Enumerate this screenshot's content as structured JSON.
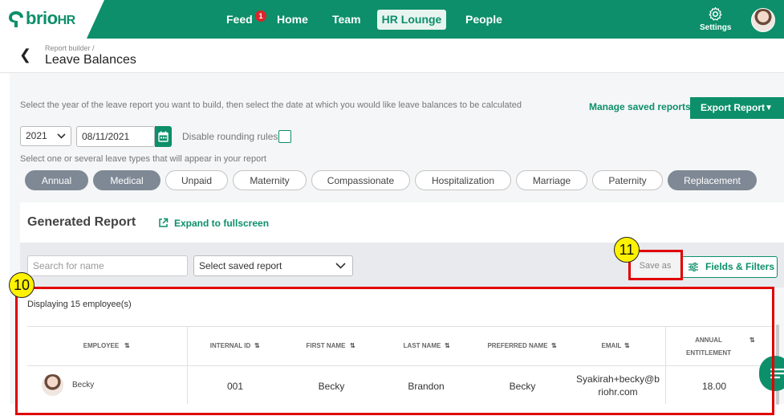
{
  "brand": {
    "name": "brio",
    "suffix": "HR"
  },
  "nav": {
    "feed": "Feed",
    "feed_badge": "1",
    "home": "Home",
    "team": "Team",
    "hr_lounge": "HR Lounge",
    "people": "People",
    "settings": "Settings"
  },
  "header": {
    "breadcrumb": "Report builder /",
    "title": "Leave Balances"
  },
  "form": {
    "info": "Select the year of the leave report you want to build, then select the date at which you would like leave balances to be calculated",
    "manage_saved": "Manage saved reports",
    "export": "Export Report",
    "year": "2021",
    "date": "08/11/2021",
    "disable_rounding": "Disable rounding rules",
    "leave_types_hint": "Select one or several leave types that will appear in your report",
    "leave_types": [
      {
        "label": "Annual",
        "selected": true
      },
      {
        "label": "Medical",
        "selected": true
      },
      {
        "label": "Unpaid",
        "selected": false
      },
      {
        "label": "Maternity",
        "selected": false
      },
      {
        "label": "Compassionate",
        "selected": false
      },
      {
        "label": "Hospitalization",
        "selected": false
      },
      {
        "label": "Marriage",
        "selected": false
      },
      {
        "label": "Paternity",
        "selected": false
      },
      {
        "label": "Replacement",
        "selected": true
      }
    ]
  },
  "report": {
    "title": "Generated Report",
    "expand": "Expand to fullscreen",
    "search_placeholder": "Search for name",
    "saved_select": "Select saved report",
    "save_as": "Save as",
    "fields_filters": "Fields & Filters",
    "displaying": "Displaying 15 employee(s)",
    "columns": [
      "EMPLOYEE",
      "INTERNAL ID",
      "FIRST NAME",
      "LAST NAME",
      "PREFERRED NAME",
      "EMAIL",
      "ANNUAL",
      "ENTITLEMENT"
    ],
    "row": {
      "employee": "Becky",
      "internal_id": "001",
      "first_name": "Becky",
      "last_name": "Brandon",
      "preferred_name": "Becky",
      "email_line1": "Syakirah+becky@b",
      "email_line2": "riohr.com",
      "annual_entitlement": "18.00"
    }
  },
  "annotations": {
    "callout_10": "10",
    "callout_11": "11"
  },
  "colors": {
    "brand_green": "#0c8f6a",
    "annotation_red": "#e00000",
    "callout_yellow": "#fff200"
  }
}
